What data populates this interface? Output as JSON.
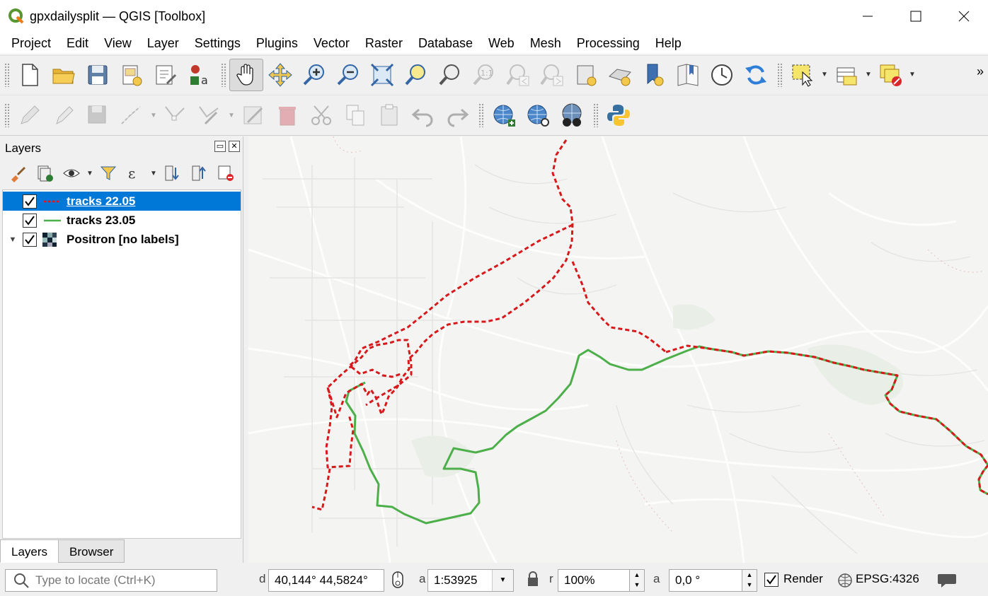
{
  "window": {
    "title": "gpxdailysplit — QGIS [Toolbox]"
  },
  "menu": [
    "Project",
    "Edit",
    "View",
    "Layer",
    "Settings",
    "Plugins",
    "Vector",
    "Raster",
    "Database",
    "Web",
    "Mesh",
    "Processing",
    "Help"
  ],
  "toolbar": {
    "overflow": "»"
  },
  "layers_panel": {
    "title": "Layers",
    "layers": [
      {
        "name": "tracks 22.05",
        "checked": true,
        "selected": true,
        "symbol": "red-dashed-line"
      },
      {
        "name": "tracks 23.05",
        "checked": true,
        "selected": false,
        "symbol": "green-line"
      },
      {
        "name": "Positron [no labels]",
        "checked": true,
        "selected": false,
        "symbol": "raster-tiles"
      }
    ],
    "tabs": [
      "Layers",
      "Browser"
    ]
  },
  "statusbar": {
    "locate_placeholder": "Type to locate (Ctrl+K)",
    "coord_label": "d",
    "coordinate": "40,144°  44,5824°",
    "scale_label": "a",
    "scale": "1:53925",
    "magnifier_label": "r",
    "magnifier": "100%",
    "rotation_label": "a",
    "rotation": "0,0 °",
    "render_label": "Render",
    "render_checked": true,
    "crs": "EPSG:4326"
  },
  "colors": {
    "track_2205": "#d7191c",
    "track_2305": "#4daf4a",
    "selection": "#0078d7"
  }
}
